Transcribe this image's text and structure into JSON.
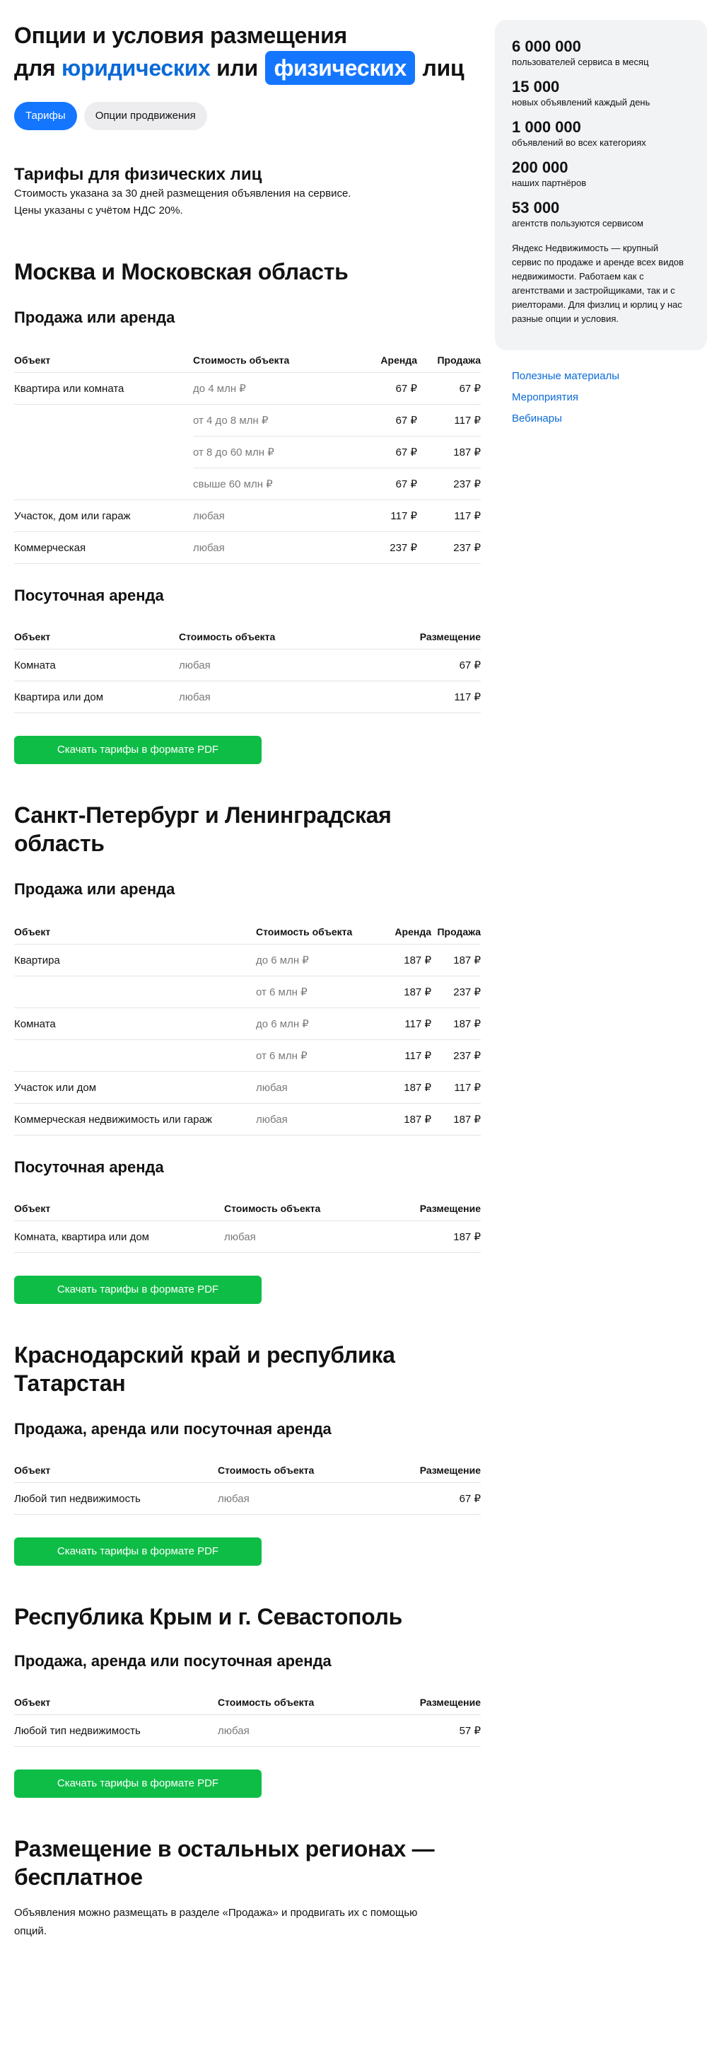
{
  "hero": {
    "line1": "Опции и условия размещения",
    "for": "для",
    "legal": "юридических",
    "or": "или",
    "individual": "физических",
    "persons": "лиц"
  },
  "tabs": [
    {
      "label": "Тарифы",
      "active": true
    },
    {
      "label": "Опции продвижения",
      "active": false
    }
  ],
  "individual_tariffs": {
    "title": "Тарифы для физических лиц",
    "note1": "Стоимость указана за 30 дней размещения объявления на сервисе.",
    "note2": "Цены указаны с учётом НДС 20%."
  },
  "moscow": {
    "title": "Москва и Московская область",
    "sale": {
      "title": "Продажа или аренда",
      "headers": [
        "Объект",
        "Стоимость объекта",
        "Аренда",
        "Продажа"
      ],
      "rows": [
        [
          "Квартира или комната",
          "до 4 млн ₽",
          "67 ₽",
          "67 ₽"
        ],
        [
          "",
          "от 4 до 8 млн ₽",
          "67 ₽",
          "117 ₽"
        ],
        [
          "",
          "от 8 до 60 млн ₽",
          "67 ₽",
          "187 ₽"
        ],
        [
          "",
          "свыше 60 млн ₽",
          "67 ₽",
          "237 ₽"
        ],
        [
          "Участок, дом или гараж",
          "любая",
          "117 ₽",
          "117 ₽"
        ],
        [
          "Коммерческая",
          "любая",
          "237 ₽",
          "237 ₽"
        ]
      ]
    },
    "daily": {
      "title": "Посуточная аренда",
      "headers": [
        "Объект",
        "Стоимость объекта",
        "Размещение"
      ],
      "rows": [
        [
          "Комната",
          "любая",
          "67 ₽"
        ],
        [
          "Квартира или дом",
          "любая",
          "117 ₽"
        ]
      ]
    },
    "button": "Скачать тарифы в формате PDF"
  },
  "spb": {
    "title_l1": "Санкт-Петербург и Ленинградская",
    "title_l2": "область",
    "sale": {
      "title": "Продажа или аренда",
      "headers": [
        "Объект",
        "Стоимость объекта",
        "Аренда",
        "Продажа"
      ],
      "rows": [
        [
          "Квартира",
          "до 6 млн ₽",
          "187 ₽",
          "187 ₽"
        ],
        [
          "",
          "от 6 млн ₽",
          "187 ₽",
          "237 ₽"
        ],
        [
          "Комната",
          "до 6 млн ₽",
          "117 ₽",
          "187 ₽"
        ],
        [
          "",
          "от 6 млн ₽",
          "117 ₽",
          "237 ₽"
        ],
        [
          "Участок или дом",
          "любая",
          "187 ₽",
          "117 ₽"
        ],
        [
          "Коммерческая недвижимость или гараж",
          "любая",
          "187 ₽",
          "187 ₽"
        ]
      ]
    },
    "daily": {
      "title": "Посуточная аренда",
      "headers": [
        "Объект",
        "Стоимость объекта",
        "Размещение"
      ],
      "rows": [
        [
          "Комната, квартира или дом",
          "любая",
          "187 ₽"
        ]
      ]
    },
    "button": "Скачать тарифы в формате PDF"
  },
  "krasnodar": {
    "title_l1": "Краснодарский край и республика",
    "title_l2": "Татарстан",
    "block": {
      "title": "Продажа, аренда или посуточная аренда",
      "headers": [
        "Объект",
        "Стоимость объекта",
        "Размещение"
      ],
      "rows": [
        [
          "Любой тип недвижимость",
          "любая",
          "67 ₽"
        ]
      ]
    },
    "button": "Скачать тарифы в формате PDF"
  },
  "crimea": {
    "title": "Республика Крым и г. Севастополь",
    "block": {
      "title": "Продажа, аренда или посуточная аренда",
      "headers": [
        "Объект",
        "Стоимость объекта",
        "Размещение"
      ],
      "rows": [
        [
          "Любой тип недвижимость",
          "любая",
          "57 ₽"
        ]
      ]
    },
    "button": "Скачать тарифы в формате PDF"
  },
  "other": {
    "title_l1": "Размещение в остальных регионах —",
    "title_l2": "бесплатное",
    "text_l1": "Объявления можно размещать в разделе «Продажа» и продвигать их с помощью",
    "text_l2": "опций."
  },
  "aside": {
    "stats": [
      {
        "value": "6 000 000",
        "label": "пользователей сервиса в месяц"
      },
      {
        "value": "15 000",
        "label": "новых объявлений каждый день"
      },
      {
        "value": "1 000 000",
        "label": "объявлений во всех категориях"
      },
      {
        "value": "200 000",
        "label": "наших партнёров"
      },
      {
        "value": "53 000",
        "label": "агентств пользуются сервисом"
      }
    ],
    "description": "Яндекс Недвижимость — крупный сервис по продаже и аренде всех видов недвижимости. Работаем как с агентствами и застройщиками, так и с риелторами. Для физлиц и юрлиц у нас разные опции и условия.",
    "links": [
      "Полезные материалы",
      "Мероприятия",
      "Вебинары"
    ]
  },
  "colors": {
    "accent": "#1476ff",
    "link": "#0a6ad8",
    "button": "#0ebd46",
    "panel": "#f2f3f5"
  }
}
